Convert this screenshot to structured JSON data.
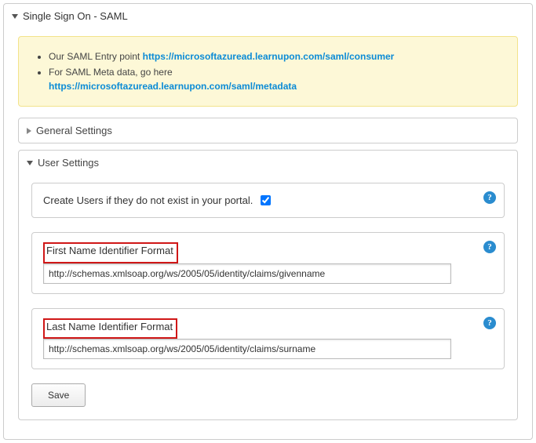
{
  "outer": {
    "title": "Single Sign On - SAML"
  },
  "notice": {
    "line1_prefix": "Our SAML Entry point ",
    "line1_link": "https://microsoftazuread.learnupon.com/saml/consumer",
    "line2_prefix": "For SAML Meta data, go here ",
    "line2_link": "https://microsoftazuread.learnupon.com/saml/metadata"
  },
  "general": {
    "title": "General Settings"
  },
  "user": {
    "title": "User Settings",
    "create_label": "Create Users if they do not exist in your portal.",
    "first_label": "First Name Identifier Format",
    "first_value": "http://schemas.xmlsoap.org/ws/2005/05/identity/claims/givenname",
    "last_label": "Last Name Identifier Format",
    "last_value": "http://schemas.xmlsoap.org/ws/2005/05/identity/claims/surname",
    "save_label": "Save"
  }
}
